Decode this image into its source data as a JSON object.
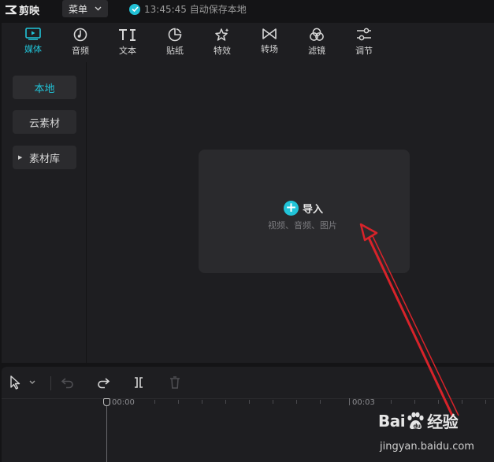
{
  "app": {
    "name": "剪映"
  },
  "titlebar": {
    "menu_label": "菜单",
    "save_status": "13:45:45 自动保存本地"
  },
  "toolbar": {
    "items": [
      {
        "label": "媒体",
        "icon": "media-icon",
        "active": true
      },
      {
        "label": "音频",
        "icon": "audio-icon",
        "active": false
      },
      {
        "label": "文本",
        "icon": "text-icon",
        "active": false
      },
      {
        "label": "贴纸",
        "icon": "sticker-icon",
        "active": false
      },
      {
        "label": "特效",
        "icon": "effects-icon",
        "active": false
      },
      {
        "label": "转场",
        "icon": "transition-icon",
        "active": false
      },
      {
        "label": "滤镜",
        "icon": "filter-icon",
        "active": false
      },
      {
        "label": "调节",
        "icon": "adjust-icon",
        "active": false
      }
    ],
    "accent_color": "#21c4d8"
  },
  "sidebar": {
    "items": [
      {
        "label": "本地",
        "active": true
      },
      {
        "label": "云素材",
        "active": false
      },
      {
        "label": "素材库",
        "active": false,
        "expandable": true
      }
    ]
  },
  "import": {
    "label": "导入",
    "hint": "视频、音频、图片"
  },
  "timeline": {
    "tools": [
      "select-icon",
      "undo-icon",
      "redo-icon",
      "split-icon",
      "delete-icon"
    ],
    "times": [
      "00:00",
      "00:03"
    ]
  },
  "watermark": {
    "logo_text_a": "Bai",
    "logo_text_b": "经验",
    "url": "jingyan.baidu.com"
  }
}
